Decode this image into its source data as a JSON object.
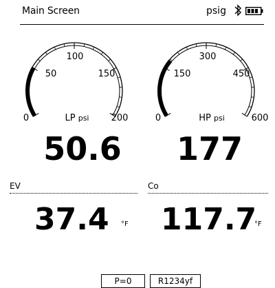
{
  "header": {
    "title": "Main Screen",
    "unit": "psig",
    "bluetooth_icon": "bluetooth-icon",
    "battery_icon": "battery-icon"
  },
  "gauges": {
    "lp": {
      "ticks": [
        "0",
        "50",
        "100",
        "150",
        "200"
      ],
      "caption": "LP",
      "unit": "psi",
      "min": 0,
      "max": 200,
      "value": 50.6,
      "value_text": "50.6"
    },
    "hp": {
      "ticks": [
        "0",
        "150",
        "300",
        "450",
        "600"
      ],
      "caption": "HP",
      "unit": "psi",
      "min": 0,
      "max": 600,
      "value": 177,
      "value_text": "177"
    }
  },
  "temperatures": {
    "ev": {
      "label": "EV",
      "value": "37.4",
      "unit": "°F"
    },
    "co": {
      "label": "Co",
      "value": "117.7",
      "unit": "°F"
    }
  },
  "status": {
    "pressure_zero": "P=0",
    "refrigerant": "R1234yf"
  }
}
